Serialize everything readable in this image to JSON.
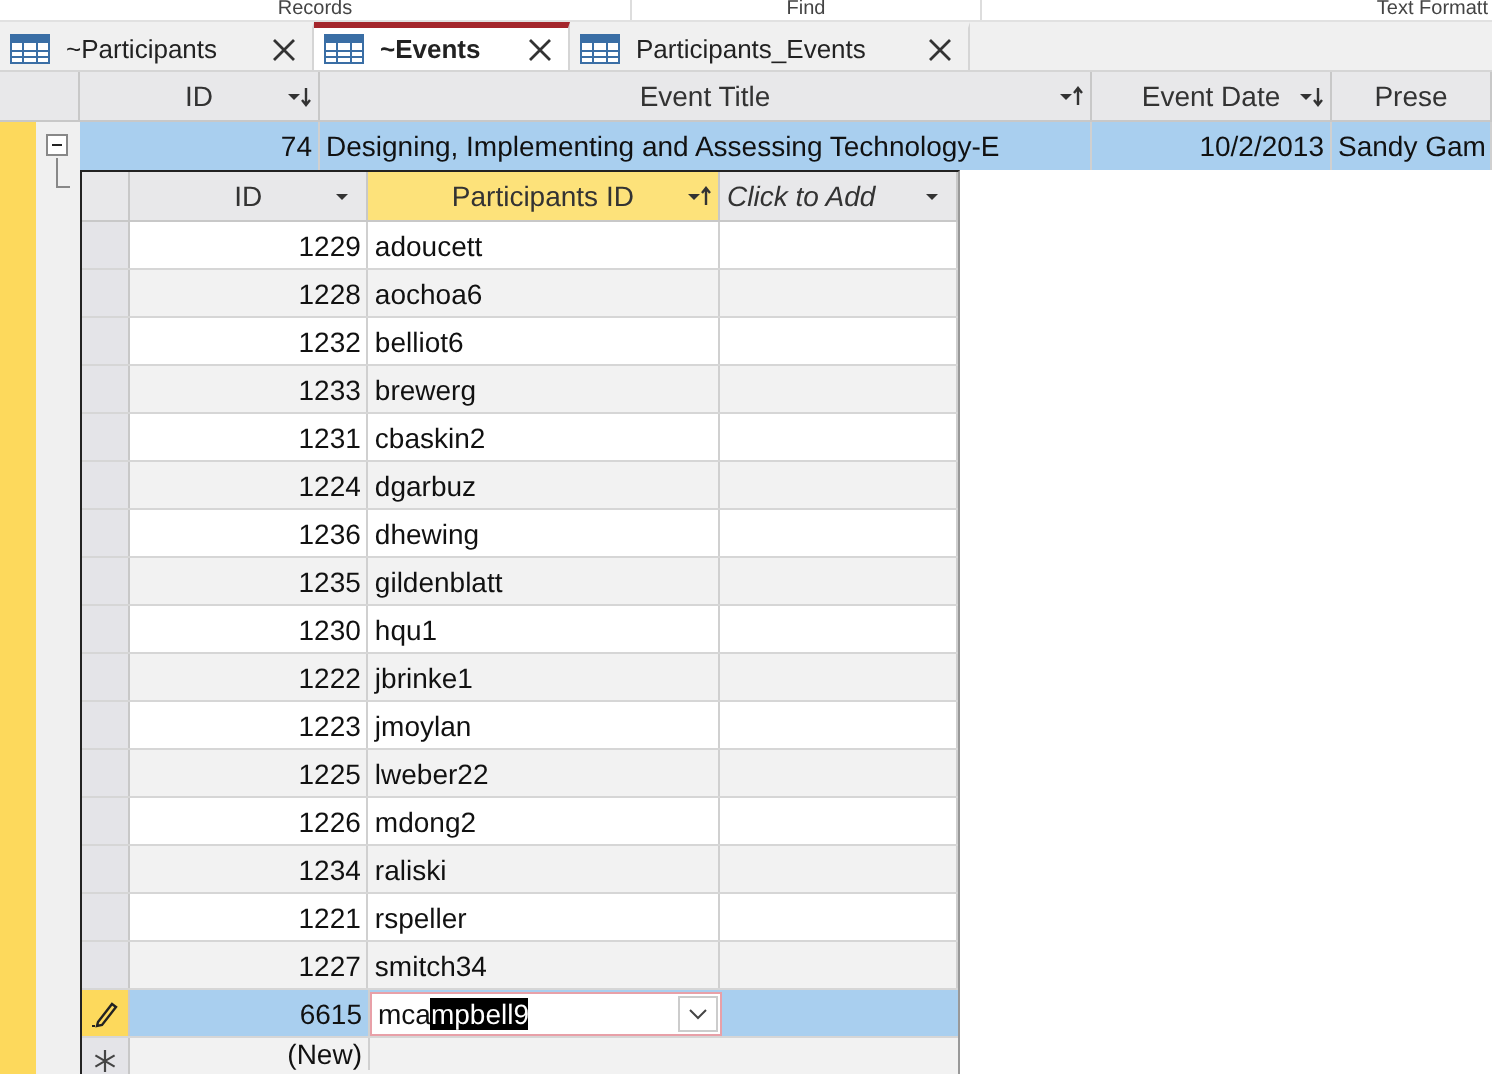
{
  "ribbon_groups": [
    "Records",
    "Find",
    "Text Formatt"
  ],
  "tabs": [
    {
      "label": "~Participants",
      "selected": false
    },
    {
      "label": "~Events",
      "selected": true
    },
    {
      "label": "Participants_Events",
      "selected": false
    }
  ],
  "main_table": {
    "columns": [
      {
        "label": "ID",
        "sort_ascending": false,
        "sort_descending": true
      },
      {
        "label": "Event Title",
        "sort_ascending": true,
        "sort_descending": false
      },
      {
        "label": "Event Date",
        "sort_ascending": false,
        "sort_descending": true
      },
      {
        "label": "Prese"
      }
    ],
    "rows": [
      {
        "cells": [
          "74",
          "Designing, Implementing and Assessing Technology-E",
          "10/2/2013",
          "Sandy Gam"
        ],
        "selected": true,
        "expanded": true
      }
    ]
  },
  "subtable": {
    "columns": [
      {
        "label": "ID",
        "sort_ascending": false,
        "italic": false,
        "selected": false
      },
      {
        "label": "Participants ID",
        "sort_ascending": true,
        "italic": false,
        "selected": true
      },
      {
        "label": "Click to Add",
        "sort_ascending": false,
        "italic": true,
        "selected": false
      }
    ],
    "rows": [
      {
        "kind": "data",
        "cells": [
          "1229",
          "adoucett"
        ]
      },
      {
        "kind": "data",
        "cells": [
          "1228",
          "aochoa6"
        ]
      },
      {
        "kind": "data",
        "cells": [
          "1232",
          "belliot6"
        ]
      },
      {
        "kind": "data",
        "cells": [
          "1233",
          "brewerg"
        ]
      },
      {
        "kind": "data",
        "cells": [
          "1231",
          "cbaskin2"
        ]
      },
      {
        "kind": "data",
        "cells": [
          "1224",
          "dgarbuz"
        ]
      },
      {
        "kind": "data",
        "cells": [
          "1236",
          "dhewing"
        ]
      },
      {
        "kind": "data",
        "cells": [
          "1235",
          "gildenblatt"
        ]
      },
      {
        "kind": "data",
        "cells": [
          "1230",
          "hqu1"
        ]
      },
      {
        "kind": "data",
        "cells": [
          "1222",
          "jbrinke1"
        ]
      },
      {
        "kind": "data",
        "cells": [
          "1223",
          "jmoylan"
        ]
      },
      {
        "kind": "data",
        "cells": [
          "1225",
          "lweber22"
        ]
      },
      {
        "kind": "data",
        "cells": [
          "1226",
          "mdong2"
        ]
      },
      {
        "kind": "data",
        "cells": [
          "1234",
          "raliski"
        ]
      },
      {
        "kind": "data",
        "cells": [
          "1221",
          "rspeller"
        ]
      },
      {
        "kind": "data",
        "cells": [
          "1227",
          "smitch34"
        ]
      },
      {
        "kind": "editing",
        "id": "6615",
        "value_parts": [
          {
            "text": "mca",
            "highlighted": false
          },
          {
            "text": "mpbell9",
            "highlighted": true
          }
        ]
      },
      {
        "kind": "new",
        "id": "(New)"
      }
    ]
  }
}
